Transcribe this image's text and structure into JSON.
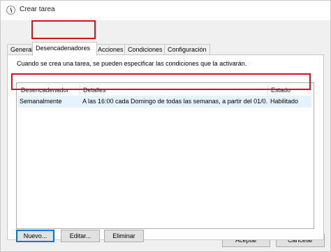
{
  "window": {
    "title": "Crear tarea",
    "icon": "clock-icon"
  },
  "tabs": [
    {
      "label": "General"
    },
    {
      "label": "Desencadenadores",
      "active": true
    },
    {
      "label": "Acciones"
    },
    {
      "label": "Condiciones"
    },
    {
      "label": "Configuración"
    }
  ],
  "panel": {
    "description": "Cuando se crea una tarea, se pueden especificar las condiciones que la activarán."
  },
  "triggers_table": {
    "columns": [
      "Desencadenador",
      "Detalles",
      "Estado"
    ],
    "rows": [
      {
        "trigger": "Semanalmente",
        "details": "A las 16:00 cada Domingo de todas las semanas, a partir del 01/0...",
        "status": "Habilitado"
      }
    ]
  },
  "panel_buttons": {
    "new": "Nuevo...",
    "edit": "Editar...",
    "delete": "Eliminar"
  },
  "dialog_buttons": {
    "ok": "Aceptar",
    "cancel": "Cancelar"
  },
  "colors": {
    "highlight": "#d8121b",
    "selection": "#e5f3ff",
    "accent": "#0078d7"
  }
}
